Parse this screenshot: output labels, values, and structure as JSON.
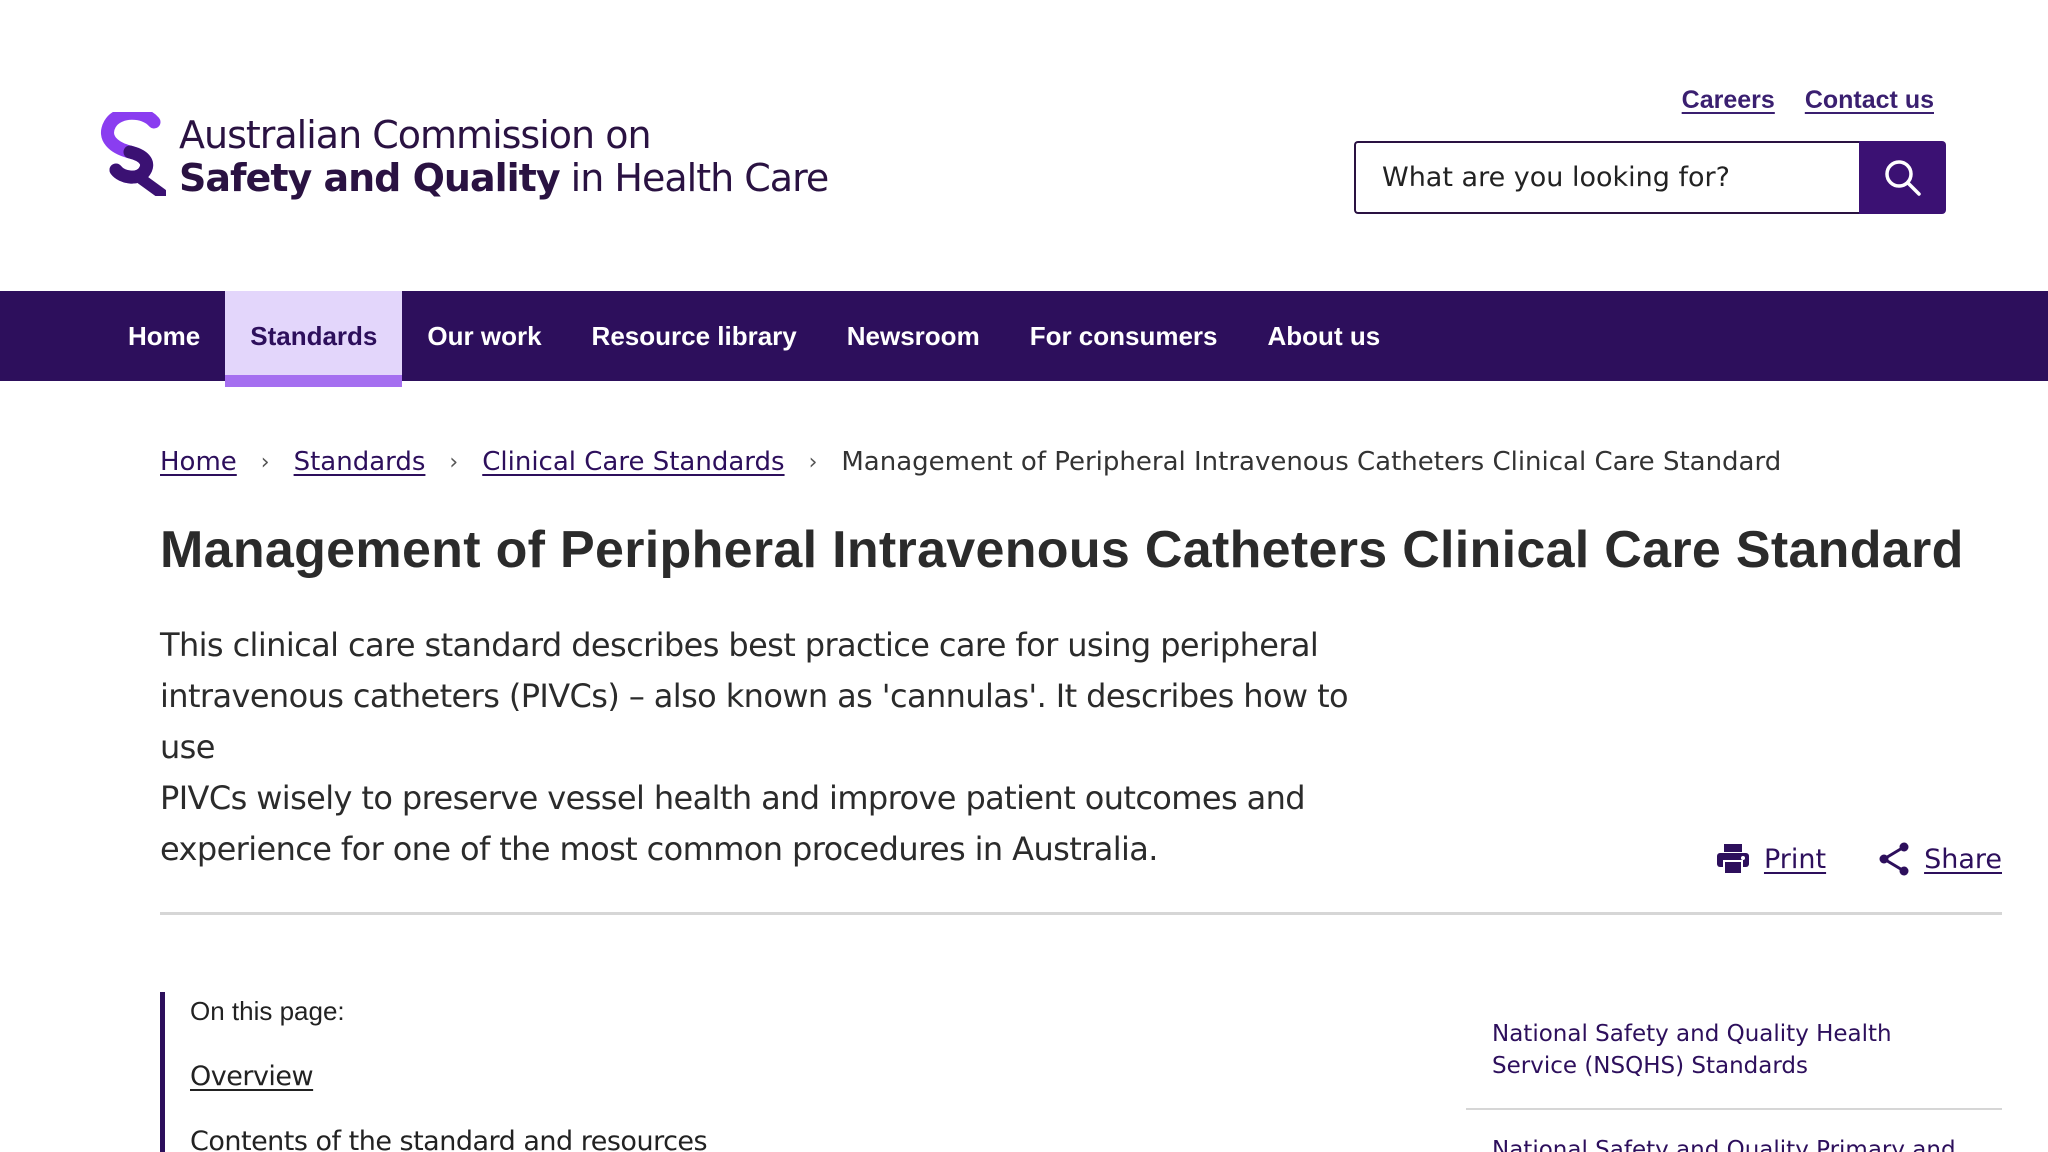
{
  "header": {
    "logo_line1": "Australian Commission on",
    "logo_line2_bold": "Safety and Quality",
    "logo_line2_rest": " in Health Care",
    "utility_links": [
      "Careers",
      "Contact us"
    ],
    "search_placeholder": "What are you looking for?"
  },
  "nav": {
    "items": [
      "Home",
      "Standards",
      "Our work",
      "Resource library",
      "Newsroom",
      "For consumers",
      "About us"
    ],
    "active": "Standards"
  },
  "breadcrumb": {
    "items": [
      "Home",
      "Standards",
      "Clinical Care Standards"
    ],
    "current": "Management of Peripheral Intravenous Catheters Clinical Care Standard"
  },
  "page": {
    "title": "Management of Peripheral Intravenous Catheters Clinical Care Standard",
    "intro_lines": [
      "This clinical care standard describes best practice care for using peripheral",
      "intravenous catheters (PIVCs) – also known as 'cannulas'. It describes how to use",
      "PIVCs wisely to preserve vessel health and improve patient outcomes and",
      "experience for one of the most common procedures in Australia."
    ],
    "print_label": "Print",
    "share_label": "Share"
  },
  "toc": {
    "title": "On this page:",
    "links": [
      "Overview",
      "Contents of the standard and resources"
    ]
  },
  "side_links": [
    "National Safety and Quality Health Service (NSQHS) Standards",
    "National Safety and Quality Primary and"
  ],
  "colors": {
    "brand_purple": "#2d0f5c",
    "accent_purple": "#a56ff0",
    "active_tab_bg": "#e3d6fb"
  }
}
